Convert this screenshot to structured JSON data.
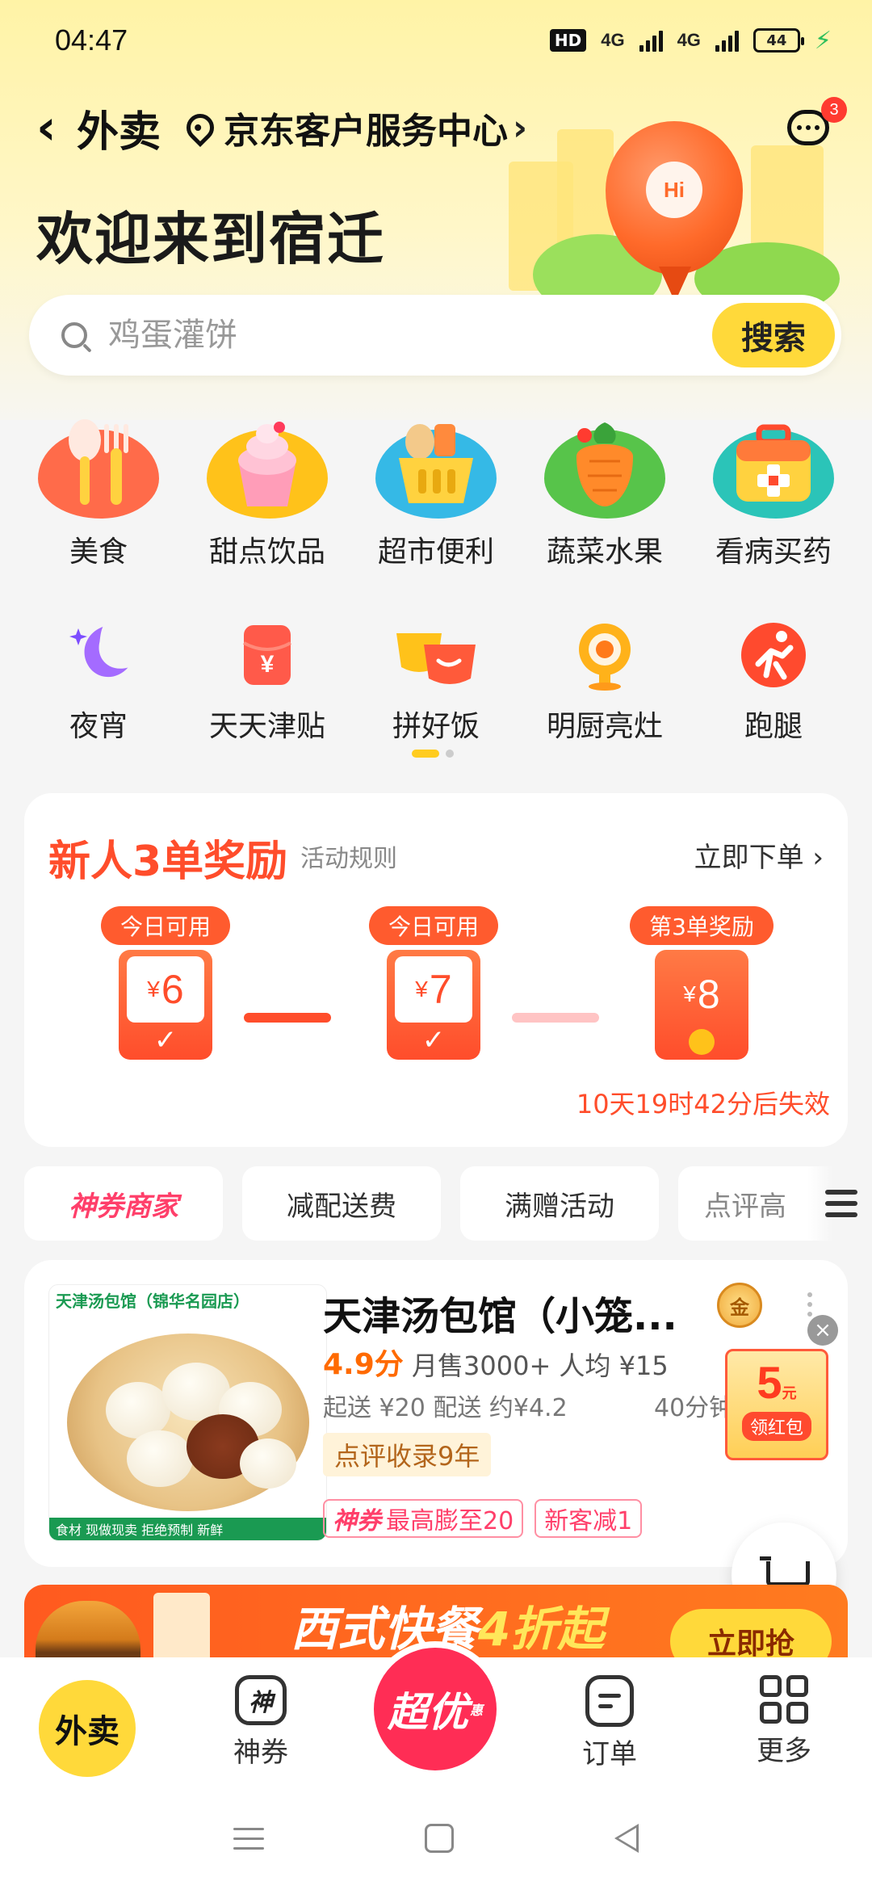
{
  "status_bar": {
    "time": "04:47",
    "hd": "HD",
    "net1": "4G",
    "net2": "4G",
    "battery": "44"
  },
  "header": {
    "back_title": "外卖",
    "location": "京东客户服务中心",
    "message_badge": "3",
    "welcome": "欢迎来到宿迁",
    "balloon_text": "Hi"
  },
  "search": {
    "placeholder": "鸡蛋灌饼",
    "button": "搜索"
  },
  "categories": {
    "row1": [
      {
        "label": "美食",
        "icon": "food-icon"
      },
      {
        "label": "甜点饮品",
        "icon": "dessert-icon"
      },
      {
        "label": "超市便利",
        "icon": "supermarket-icon"
      },
      {
        "label": "蔬菜水果",
        "icon": "vegetable-icon"
      },
      {
        "label": "看病买药",
        "icon": "medicine-icon"
      }
    ],
    "row2": [
      {
        "label": "夜宵",
        "icon": "moon-icon"
      },
      {
        "label": "天天津贴",
        "icon": "subsidy-icon"
      },
      {
        "label": "拼好饭",
        "icon": "group-meal-icon"
      },
      {
        "label": "明厨亮灶",
        "icon": "kitchen-camera-icon"
      },
      {
        "label": "跑腿",
        "icon": "errand-icon"
      }
    ]
  },
  "promo": {
    "title": "新人3单奖励",
    "rules": "活动规则",
    "order_now": "立即下单 ›",
    "rewards": [
      {
        "tag": "今日可用",
        "currency": "¥",
        "amount": "6",
        "mark": "✓"
      },
      {
        "tag": "今日可用",
        "currency": "¥",
        "amount": "7",
        "mark": "✓"
      },
      {
        "tag": "第3单奖励",
        "currency": "¥",
        "amount": "8"
      }
    ],
    "expire": "10天19时42分后失效"
  },
  "filters": [
    "神券商家",
    "减配送费",
    "满赠活动",
    "点评高"
  ],
  "shop": {
    "img_title": "天津汤包馆（锦华名园店）",
    "img_footer": "食材 现做现卖 拒绝预制 新鲜",
    "name": "天津汤包馆（小笼...",
    "medal": "金",
    "rating": "4.9分",
    "sales": "月售3000+  人均 ¥15",
    "delivery": "起送 ¥20  配送 约¥4.2",
    "time": "40分钟",
    "tag": "点评收录9年",
    "coupons": [
      {
        "brand": "神券",
        "text": "最高膨至20"
      },
      {
        "brand": "",
        "text": "新客减1"
      }
    ]
  },
  "red_packet": {
    "amount": "5",
    "unit": "元",
    "label": "领红包",
    "close": "×"
  },
  "banner": {
    "text_a": "西式快餐",
    "text_b": "4折起",
    "button": "立即抢"
  },
  "bottom_nav": {
    "home": "外卖",
    "coupon_icon": "神",
    "coupon": "神券",
    "center": "超优",
    "center_small": "惠",
    "orders": "订单",
    "more": "更多"
  },
  "colors": {
    "brand_yellow": "#ffd93a",
    "accent_red": "#ff4d2b",
    "center_pink": "#ff2d55"
  }
}
